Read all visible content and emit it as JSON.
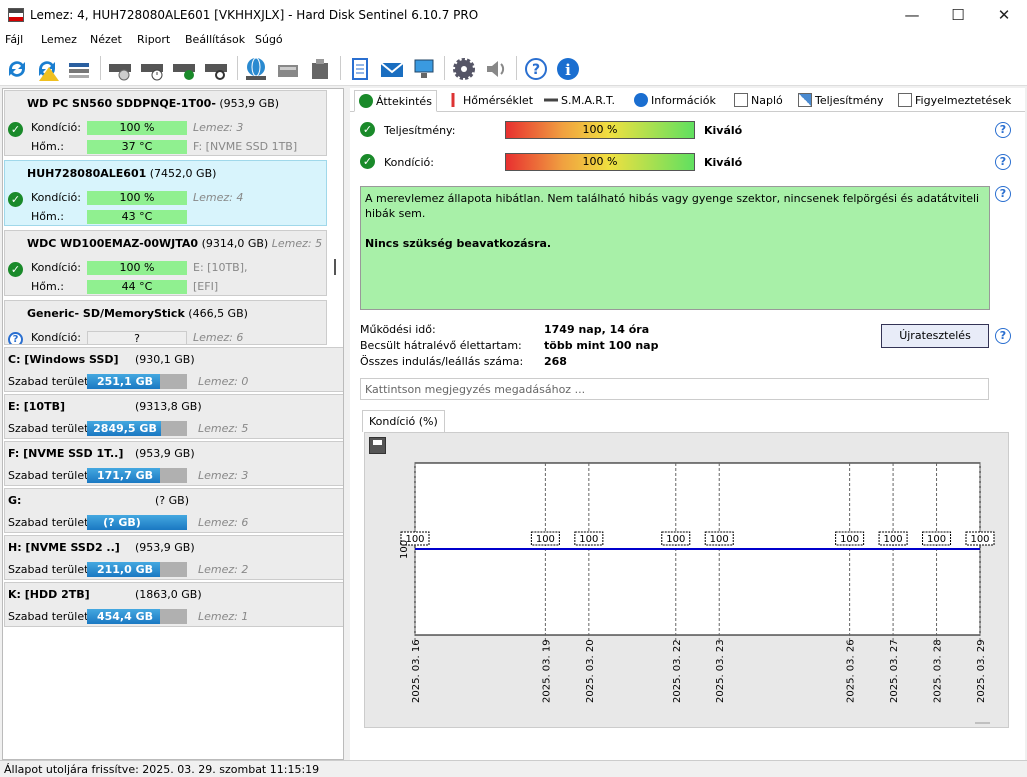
{
  "window": {
    "title": "Lemez: 4, HUH728080ALE601 [VKHHXJLX]  -  Hard Disk Sentinel 6.10.7 PRO"
  },
  "menu": [
    "Fájl",
    "Lemez",
    "Nézet",
    "Riport",
    "Beállítások",
    "Súgó"
  ],
  "toolbar_icons": [
    "refresh-icon",
    "refresh-warning-icon",
    "disk-list-icon",
    "disk-test-icon",
    "disk-schedule-icon",
    "disk-ok-icon",
    "disk-search-icon",
    "network-globe-icon",
    "external-disk-icon",
    "usb-disk-icon",
    "notes-icon",
    "email-icon",
    "network-computer-icon",
    "gear-icon",
    "speaker-icon",
    "help-icon",
    "info-icon"
  ],
  "disks": [
    {
      "name": "WD PC SN560 SDDPNQE-1T00-",
      "size": "(953,9 GB)",
      "rows": [
        {
          "label": "Kondíció:",
          "value": "100 %",
          "note": "Lemez: 3"
        },
        {
          "label": "Hőm.:",
          "value": "37 °C",
          "note": "F: [NVME SSD 1TB]"
        }
      ]
    },
    {
      "name": "HUH728080ALE601",
      "size": "(7452,0 GB)",
      "rows": [
        {
          "label": "Kondíció:",
          "value": "100 %",
          "note": "Lemez: 4"
        },
        {
          "label": "Hőm.:",
          "value": "43 °C",
          "note": ""
        }
      ]
    },
    {
      "name": "WDC WD100EMAZ-00WJTA0",
      "size": "(9314,0 GB)",
      "lemez": "Lemez: 5",
      "rows": [
        {
          "label": "Kondíció:",
          "value": "100 %",
          "note": "E: [10TB],"
        },
        {
          "label": "Hőm.:",
          "value": "44 °C",
          "note": "[EFI]"
        }
      ]
    },
    {
      "name": "Generic- SD/MemoryStick",
      "size": "(466,5 GB)",
      "rows": [
        {
          "label": "Kondíció:",
          "value": "?",
          "note": "Lemez: 6"
        }
      ]
    }
  ],
  "partitions": [
    {
      "name": "C: [Windows SSD]",
      "size": "(930,1 GB)",
      "free_label": "Szabad terület",
      "free": "251,1 GB",
      "free_fraction": 0.73,
      "lemez": "Lemez: 0"
    },
    {
      "name": "E: [10TB]",
      "size": "(9313,8 GB)",
      "free_label": "Szabad terület",
      "free": "2849,5 GB",
      "free_fraction": 0.74,
      "lemez": "Lemez: 5"
    },
    {
      "name": "F: [NVME SSD 1T..]",
      "size": "(953,9 GB)",
      "free_label": "Szabad terület",
      "free": "171,7 GB",
      "free_fraction": 0.73,
      "lemez": "Lemez: 3"
    },
    {
      "name": "G:",
      "size": "(? GB)",
      "free_label": "Szabad terület",
      "free": "(? GB)",
      "free_fraction": 1.0,
      "lemez": "Lemez: 6"
    },
    {
      "name": "H: [NVME SSD2 ..]",
      "size": "(953,9 GB)",
      "free_label": "Szabad terület",
      "free": "211,0 GB",
      "free_fraction": 0.73,
      "lemez": "Lemez: 2"
    },
    {
      "name": "K: [HDD 2TB]",
      "size": "(1863,0 GB)",
      "free_label": "Szabad terület",
      "free": "454,4 GB",
      "free_fraction": 0.73,
      "lemez": "Lemez: 1"
    }
  ],
  "tabs": [
    "Áttekintés",
    "Hőmérséklet",
    "S.M.A.R.T.",
    "Információk",
    "Napló",
    "Teljesítmény",
    "Figyelmeztetések"
  ],
  "metrics": [
    {
      "label": "Teljesítmény:",
      "value": "100 %",
      "grade": "Kiváló"
    },
    {
      "label": "Kondíció:",
      "value": "100 %",
      "grade": "Kiváló"
    }
  ],
  "status": {
    "text": "A merevlemez állapota hibátlan. Nem található hibás vagy gyenge szektor, nincsenek felpörgési és adatátviteli hibák sem.",
    "advice": "Nincs szükség beavatkozásra."
  },
  "info": [
    {
      "label": "Működési idő:",
      "value": "1749 nap, 14 óra"
    },
    {
      "label": "Becsült hátralévő élettartam:",
      "value": "több mint 100 nap"
    },
    {
      "label": "Összes indulás/leállás száma:",
      "value": "268"
    }
  ],
  "retest_label": "Újratesztelés",
  "note_placeholder": "Kattintson megjegyzés megadásához ...",
  "chart_tab": "Kondíció  (%)",
  "chart_data": {
    "type": "line",
    "x": [
      "2025. 03. 16",
      "2025. 03. 19",
      "2025. 03. 20",
      "2025. 03. 22",
      "2025. 03. 23",
      "2025. 03. 26",
      "2025. 03. 27",
      "2025. 03. 28",
      "2025. 03. 29"
    ],
    "day_offsets": [
      0,
      3,
      4,
      6,
      7,
      10,
      11,
      12,
      13
    ],
    "values": [
      100,
      100,
      100,
      100,
      100,
      100,
      100,
      100,
      100
    ],
    "ytick": "100",
    "ylim": [
      0,
      200
    ],
    "grid": true,
    "color": "#0000cc"
  },
  "statusbar": "Állapot utoljára frissítve: 2025. 03. 29. szombat 11:15:19"
}
